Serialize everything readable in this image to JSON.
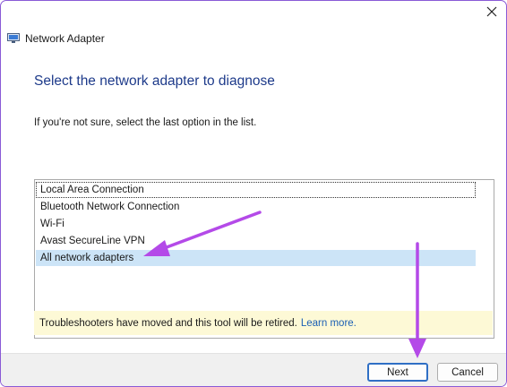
{
  "window": {
    "title": "Network Adapter",
    "icon": "network-adapter-icon",
    "close_icon": "close-icon"
  },
  "main": {
    "heading": "Select the network adapter to diagnose",
    "subtext": "If you're not sure, select the last option in the list."
  },
  "adapter_list": {
    "items": [
      {
        "label": "Local Area Connection"
      },
      {
        "label": "Bluetooth Network Connection"
      },
      {
        "label": "Wi-Fi"
      },
      {
        "label": "Avast SecureLine VPN"
      },
      {
        "label": "All network adapters"
      }
    ],
    "selected_label": "All network adapters",
    "focused_label": "Local Area Connection"
  },
  "info_bar": {
    "message": "Troubleshooters have moved and this tool will be retired.",
    "link": "Learn more."
  },
  "footer": {
    "next_label": "Next",
    "cancel_label": "Cancel"
  },
  "colors": {
    "heading": "#1d3a8a",
    "selection": "#cce4f7",
    "info_bar": "#fdf9d6",
    "link": "#1a5fb4",
    "annotation_arrow": "#b44ae8"
  }
}
